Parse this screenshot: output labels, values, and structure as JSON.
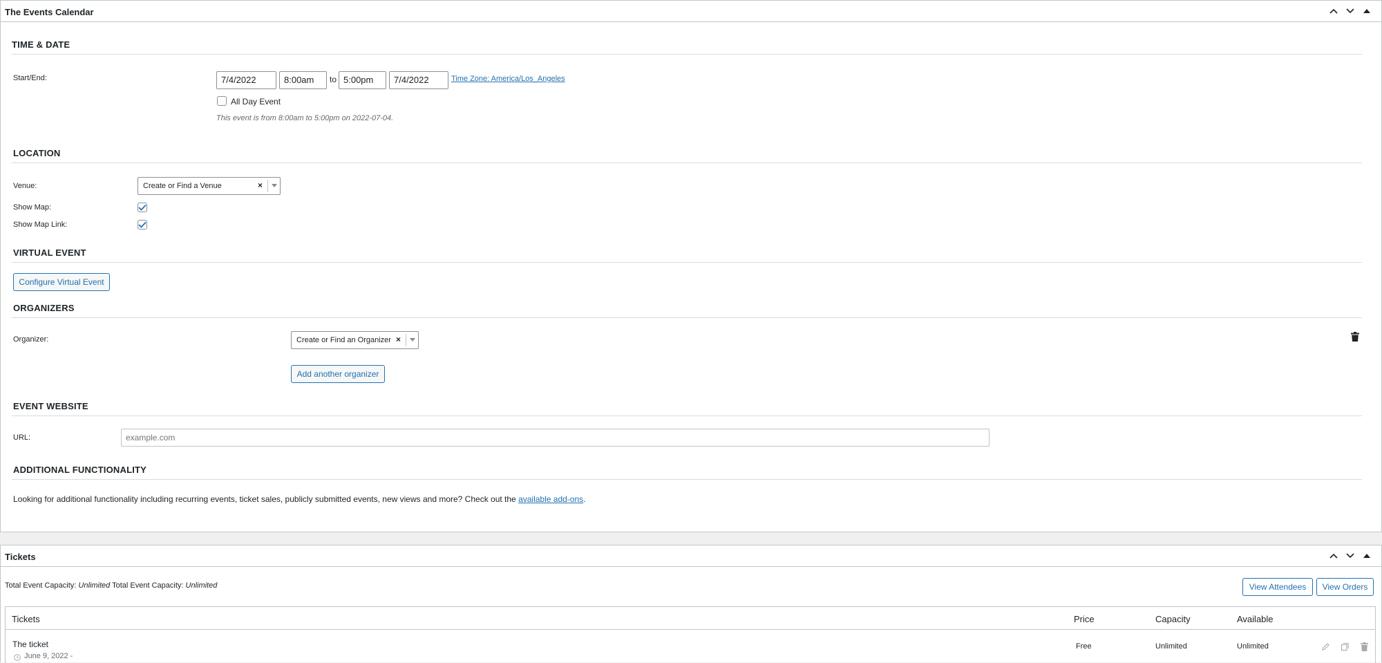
{
  "events_box": {
    "title": "The Events Calendar",
    "time_date": {
      "heading": "TIME & DATE",
      "start_end_label": "Start/End:",
      "start_date": "7/4/2022",
      "start_time": "8:00am",
      "to_text": "to",
      "end_time": "5:00pm",
      "end_date": "7/4/2022",
      "timezone_link": "Time Zone: America/Los_Angeles",
      "all_day_label": "All Day Event",
      "all_day_checked": false,
      "summary": "This event is from 8:00am to 5:00pm on 2022-07-04."
    },
    "location": {
      "heading": "LOCATION",
      "venue_label": "Venue:",
      "venue_placeholder": "Create or Find a Venue",
      "show_map_label": "Show Map:",
      "show_map_checked": true,
      "show_map_link_label": "Show Map Link:",
      "show_map_link_checked": true
    },
    "virtual_event": {
      "heading": "VIRTUAL EVENT",
      "configure_button": "Configure Virtual Event"
    },
    "organizers": {
      "heading": "ORGANIZERS",
      "organizer_label": "Organizer:",
      "organizer_placeholder": "Create or Find an Organizer",
      "add_button": "Add another organizer"
    },
    "event_website": {
      "heading": "EVENT WEBSITE",
      "url_label": "URL:",
      "url_placeholder": "example.com"
    },
    "additional": {
      "heading": "ADDITIONAL FUNCTIONALITY",
      "text_before": "Looking for additional functionality including recurring events, ticket sales, publicly submitted events, new views and more? Check out the ",
      "link_text": "available add-ons",
      "text_after": "."
    }
  },
  "tickets_box": {
    "title": "Tickets",
    "capacity_label_1": "Total Event Capacity: ",
    "capacity_value_1": "Unlimited",
    "capacity_label_2": " Total Event Capacity: ",
    "capacity_value_2": "Unlimited",
    "view_attendees_button": "View Attendees",
    "view_orders_button": "View Orders",
    "table": {
      "headers": {
        "tickets": "Tickets",
        "price": "Price",
        "capacity": "Capacity",
        "available": "Available"
      },
      "rows": [
        {
          "name": "The ticket",
          "date": "June 9, 2022 -",
          "price": "Free",
          "capacity": "Unlimited",
          "available": "Unlimited"
        }
      ]
    }
  },
  "icons": [
    "chevron-up-icon",
    "chevron-down-icon",
    "collapse-arrow-icon",
    "trash-icon",
    "pencil-icon",
    "duplicate-icon",
    "clock-icon",
    "checkmark-icon"
  ],
  "colors": {
    "link": "#2271b1",
    "border": "#c3c4c7",
    "background": "#f0f0f1",
    "text": "#1d2327",
    "muted": "#646970"
  }
}
